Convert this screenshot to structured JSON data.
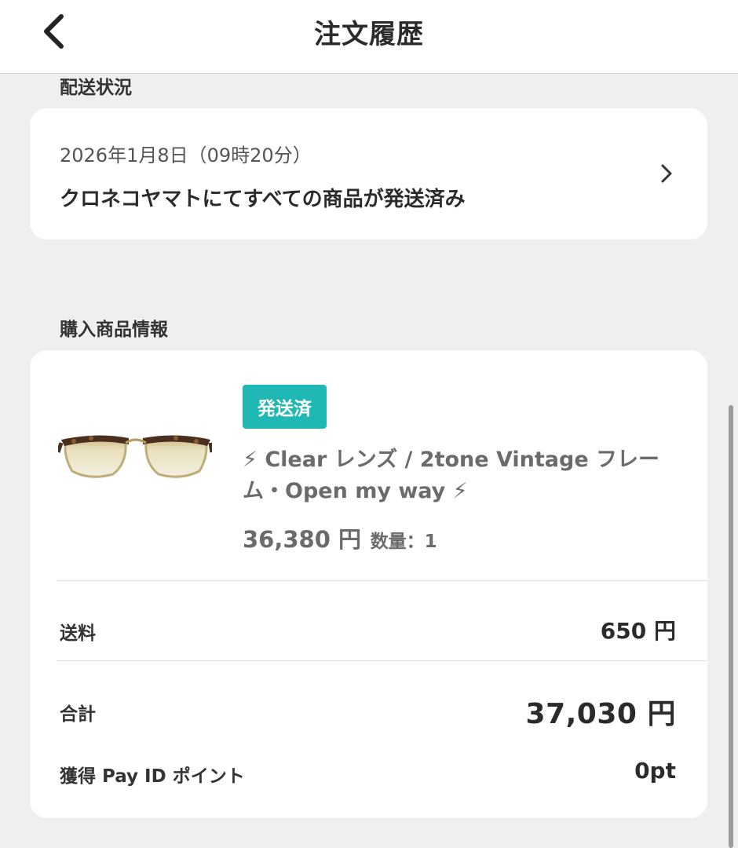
{
  "header": {
    "title": "注文履歴",
    "back_icon": "chevron-left-icon"
  },
  "shipping": {
    "section_label": "配送状況",
    "date": "2026年1月8日（09時20分）",
    "status": "クロネコヤマトにてすべての商品が発送済み",
    "chevron_icon": "chevron-right-icon"
  },
  "items": {
    "section_label": "購入商品情報",
    "product": {
      "badge": "発送済",
      "badge_color": "#1fb8b5",
      "name": "⚡ Clear レンズ / 2tone Vintage フレーム・Open my way ⚡",
      "price": "36,380 円",
      "quantity": "数量：1",
      "image_icon": "eyeglasses-image"
    },
    "shipping_fee": {
      "label": "送料",
      "value": "650 円"
    },
    "total": {
      "label": "合計",
      "value": "37,030 円"
    },
    "points": {
      "label": "獲得 Pay ID ポイント",
      "value": "0pt"
    }
  }
}
